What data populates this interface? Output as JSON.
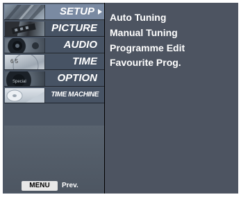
{
  "menu": {
    "items": [
      {
        "label": "SETUP",
        "active": true
      },
      {
        "label": "PICTURE",
        "active": false
      },
      {
        "label": "AUDIO",
        "active": false
      },
      {
        "label": "TIME",
        "active": false
      },
      {
        "label": "OPTION",
        "active": false
      },
      {
        "label": "TIME MACHINE",
        "active": false
      }
    ],
    "thumb_labels": {
      "time_digits": "6 5",
      "option_badge": "Special"
    }
  },
  "submenu": {
    "items": [
      "Auto Tuning",
      "Manual Tuning",
      "Programme Edit",
      "Favourite Prog."
    ]
  },
  "footer": {
    "menu_button": "MENU",
    "prev_label": "Prev."
  }
}
